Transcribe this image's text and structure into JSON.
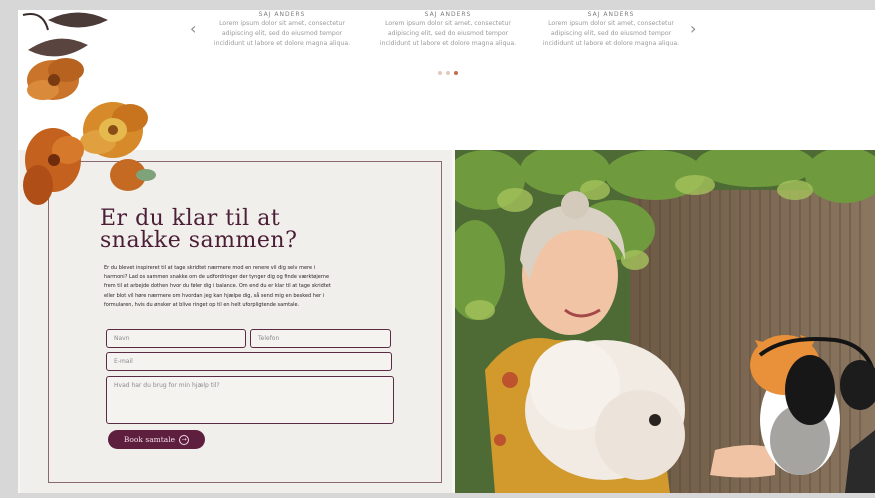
{
  "testimonials": {
    "prev_icon": "chevron-left-icon",
    "next_icon": "chevron-right-icon",
    "prev_glyph": "‹",
    "next_glyph": "›",
    "items": [
      {
        "title": "SAJ ANDERS",
        "lines": [
          "Lorem ipsum dolor sit amet, consectetur",
          "adipiscing elit, sed do eiusmod tempor",
          "incididunt ut labore et dolore magna aliqua."
        ]
      },
      {
        "title": "SAJ ANDERS",
        "lines": [
          "Lorem ipsum dolor sit amet, consectetur",
          "adipiscing elit, sed do eiusmod tempor",
          "incididunt ut labore et dolore magna aliqua."
        ]
      },
      {
        "title": "SAJ ANDERS",
        "lines": [
          "Lorem ipsum dolor sit amet, consectetur",
          "adipiscing elit, sed do eiusmod tempor",
          "incididunt ut labore et dolore magna aliqua."
        ]
      }
    ],
    "dots": 3,
    "active_dot": 2
  },
  "contact": {
    "headline_line1": "Er du klar til at",
    "headline_line2": "snakke sammen?",
    "body": [
      "Er du blevet inspireret til at tage skridtet nærmere mod en renere vil dig selv mere i",
      "harmoni? Lad os sammen snakke om de udfordringer der tynger dig og finde værktøjerne",
      "frem til at arbejde dothen hvor du føler dig i balance. Om end du er klar til at tage skridtet",
      "eller blot vil høre nærmere om hvordan jeg kan hjælpe dig, så send mig en besked her i",
      "formularen, hvis du ønsker at blive ringet op til en helt uforpligtende samtale."
    ],
    "name_placeholder": "Navn",
    "phone_placeholder": "Telefon",
    "email_placeholder": "E-mail",
    "message_placeholder": "Hvad har du brug for min hjælp til?",
    "button_label": "Book samtale",
    "button_icon": "arrow-right-circle-icon",
    "button_glyph": "→",
    "colors": {
      "accent": "#5e1f3f",
      "headline": "#4b1d36",
      "card_bg": "#f0efeb"
    }
  },
  "photo": {
    "icon": "photo-woman-with-dog-and-cat"
  }
}
